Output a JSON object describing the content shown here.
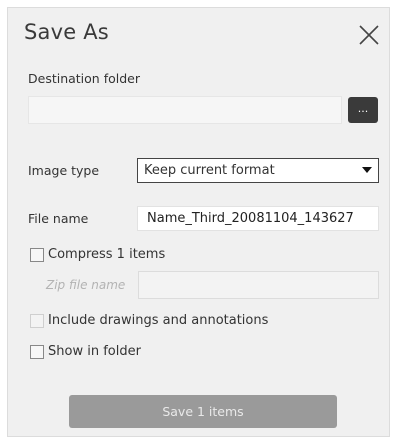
{
  "dialog": {
    "title": "Save As",
    "close_icon": "close-icon"
  },
  "destination": {
    "label": "Destination folder",
    "value": "",
    "browse_label": "..."
  },
  "image_type": {
    "label": "Image type",
    "selected": "Keep current format",
    "arrow_icon": "dropdown-arrow-icon"
  },
  "file_name": {
    "label": "File name",
    "value": "Name_Third_20081104_143627"
  },
  "compress": {
    "label": "Compress 1 items",
    "checked": false,
    "zip_label": "Zip file name",
    "zip_value": ""
  },
  "include_drawings": {
    "label": "Include drawings and annotations",
    "checked": false,
    "enabled": false
  },
  "show_in_folder": {
    "label": "Show in folder",
    "checked": false
  },
  "save_button": {
    "label": "Save 1 items",
    "enabled": false
  }
}
